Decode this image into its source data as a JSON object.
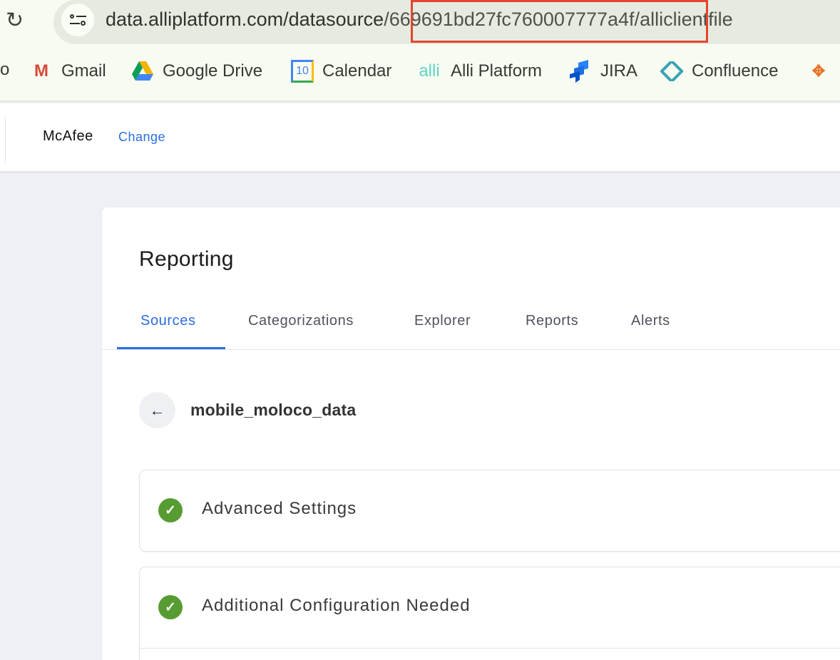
{
  "browser": {
    "url_host": "data.alliplatform.com/datasource",
    "url_highlighted": "/669691bd27fc760007777a4f/",
    "url_tail": "alliclientfile",
    "highlight_color": "#e8432e",
    "bookmarks": [
      {
        "label": "Gmail",
        "icon": "gmail-icon"
      },
      {
        "label": "Google Drive",
        "icon": "google-drive-icon"
      },
      {
        "label": "Calendar",
        "icon": "calendar-icon",
        "icon_text": "10"
      },
      {
        "label": "Alli Platform",
        "icon": "alli-icon",
        "icon_text": "alli"
      },
      {
        "label": "JIRA",
        "icon": "jira-icon"
      },
      {
        "label": "Confluence",
        "icon": "confluence-icon"
      }
    ]
  },
  "header": {
    "org": "McAfee",
    "change_label": "Change"
  },
  "page": {
    "title": "Reporting",
    "tabs": [
      {
        "label": "Sources",
        "active": true
      },
      {
        "label": "Categorizations"
      },
      {
        "label": "Explorer"
      },
      {
        "label": "Reports"
      },
      {
        "label": "Alerts"
      }
    ],
    "source_name": "mobile_moloco_data",
    "sections": [
      {
        "label": "Advanced Settings",
        "status": "complete"
      },
      {
        "label": "Additional Configuration Needed",
        "status": "complete"
      }
    ]
  },
  "colors": {
    "accent": "#2b6ee0",
    "success": "#579c32"
  }
}
